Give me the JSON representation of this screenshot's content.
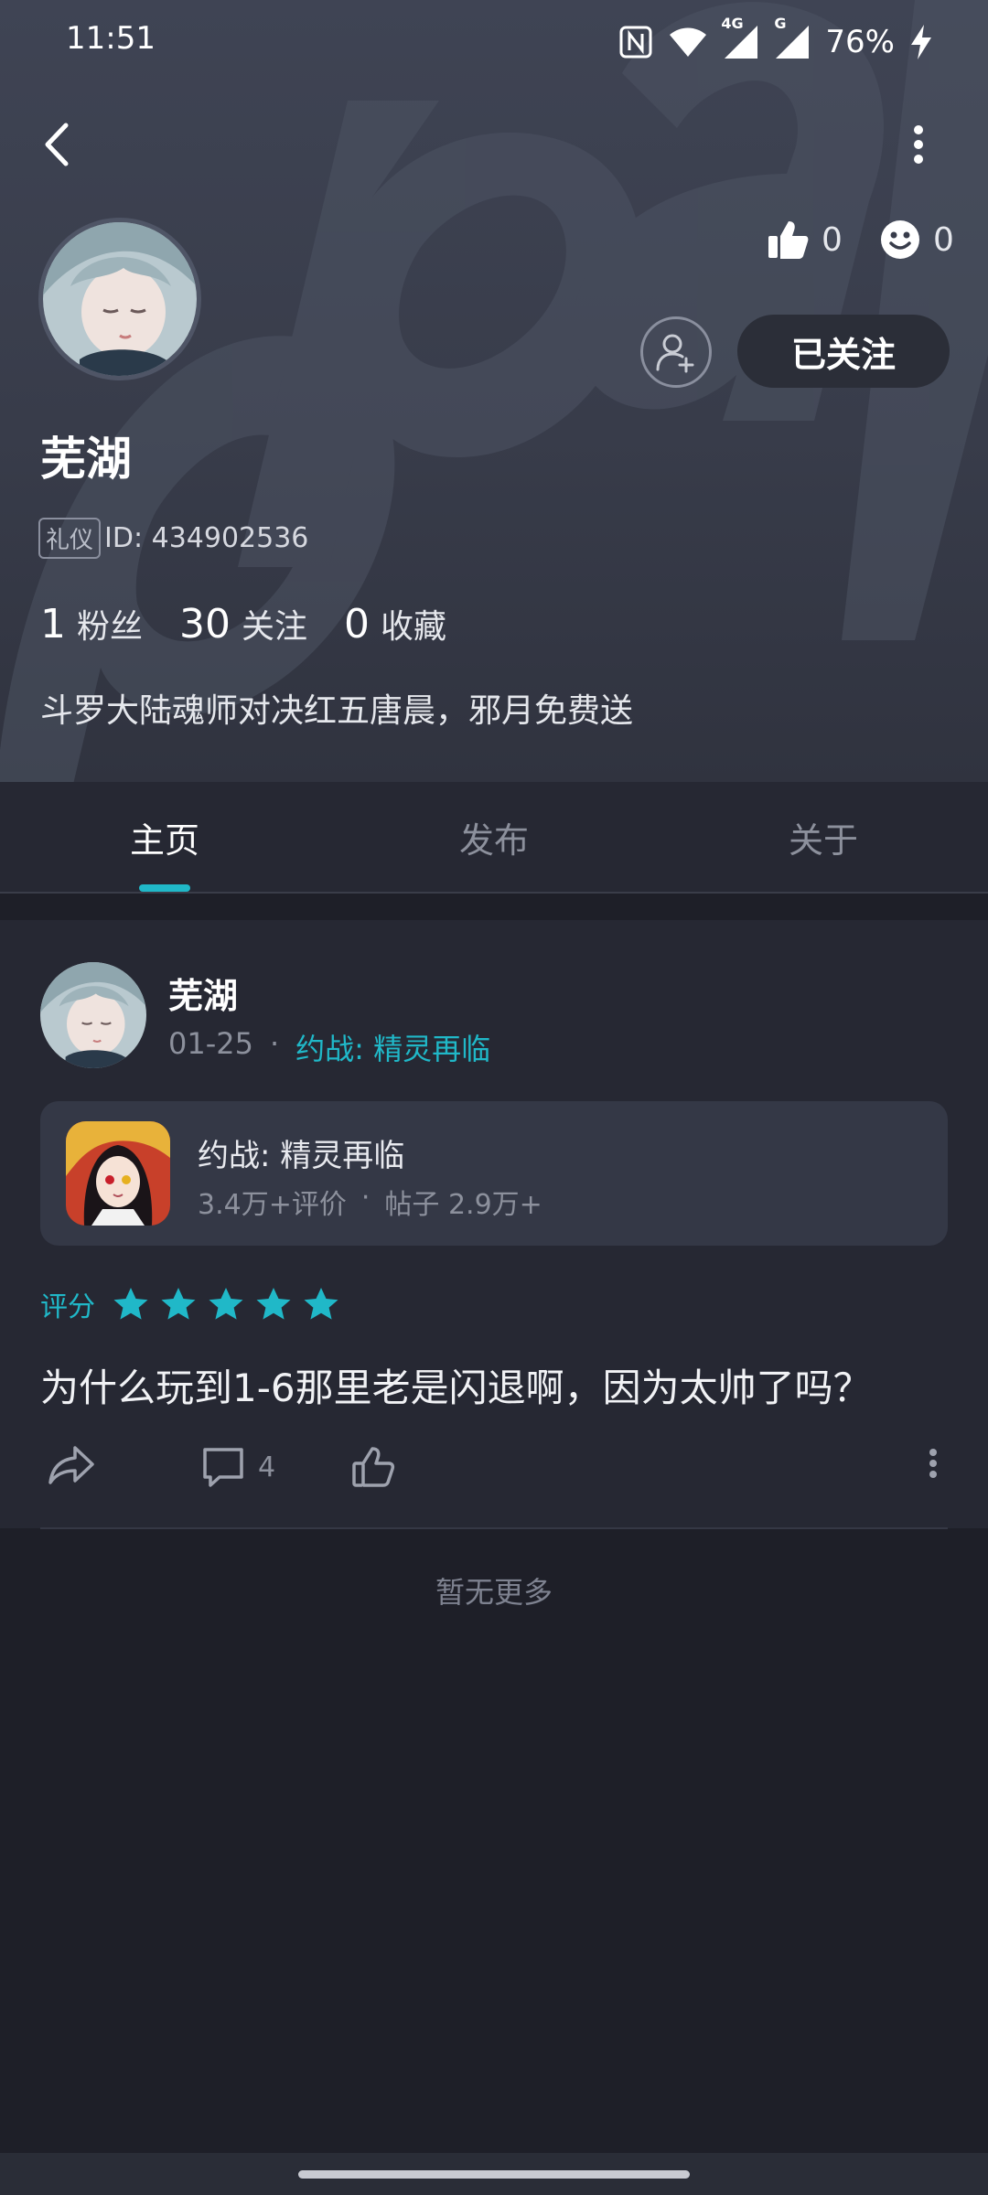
{
  "status_bar": {
    "time": "11:51",
    "battery": "76%",
    "network_labels": [
      "4G",
      "G"
    ]
  },
  "profile": {
    "likes_count": "0",
    "reactions_count": "0",
    "follow_label": "已关注",
    "username": "芜湖",
    "tag": "礼仪",
    "id_text": "ID: 434902536",
    "fans_count": "1",
    "fans_label": "粉丝",
    "following_count": "30",
    "following_label": "关注",
    "favorites_count": "0",
    "favorites_label": "收藏",
    "bio": "斗罗大陆魂师对决红五唐晨，邪月免费送"
  },
  "tabs": [
    {
      "label": "主页",
      "active": true
    },
    {
      "label": "发布",
      "active": false
    },
    {
      "label": "关于",
      "active": false
    }
  ],
  "post": {
    "author": "芜湖",
    "date": "01-25",
    "separator": "·",
    "game_link": "约战: 精灵再临",
    "game": {
      "name": "约战: 精灵再临",
      "reviews": "3.4万+评价",
      "separator": "·",
      "posts": "帖子 2.9万+"
    },
    "rating_label": "评分",
    "rating_stars": 5,
    "text": "为什么玩到1-6那里老是闪退啊，因为太帅了吗？",
    "comment_count": "4"
  },
  "footer": {
    "no_more": "暂无更多"
  },
  "colors": {
    "accent": "#20b8c8",
    "background": "#1e1f28",
    "card": "#262833"
  }
}
